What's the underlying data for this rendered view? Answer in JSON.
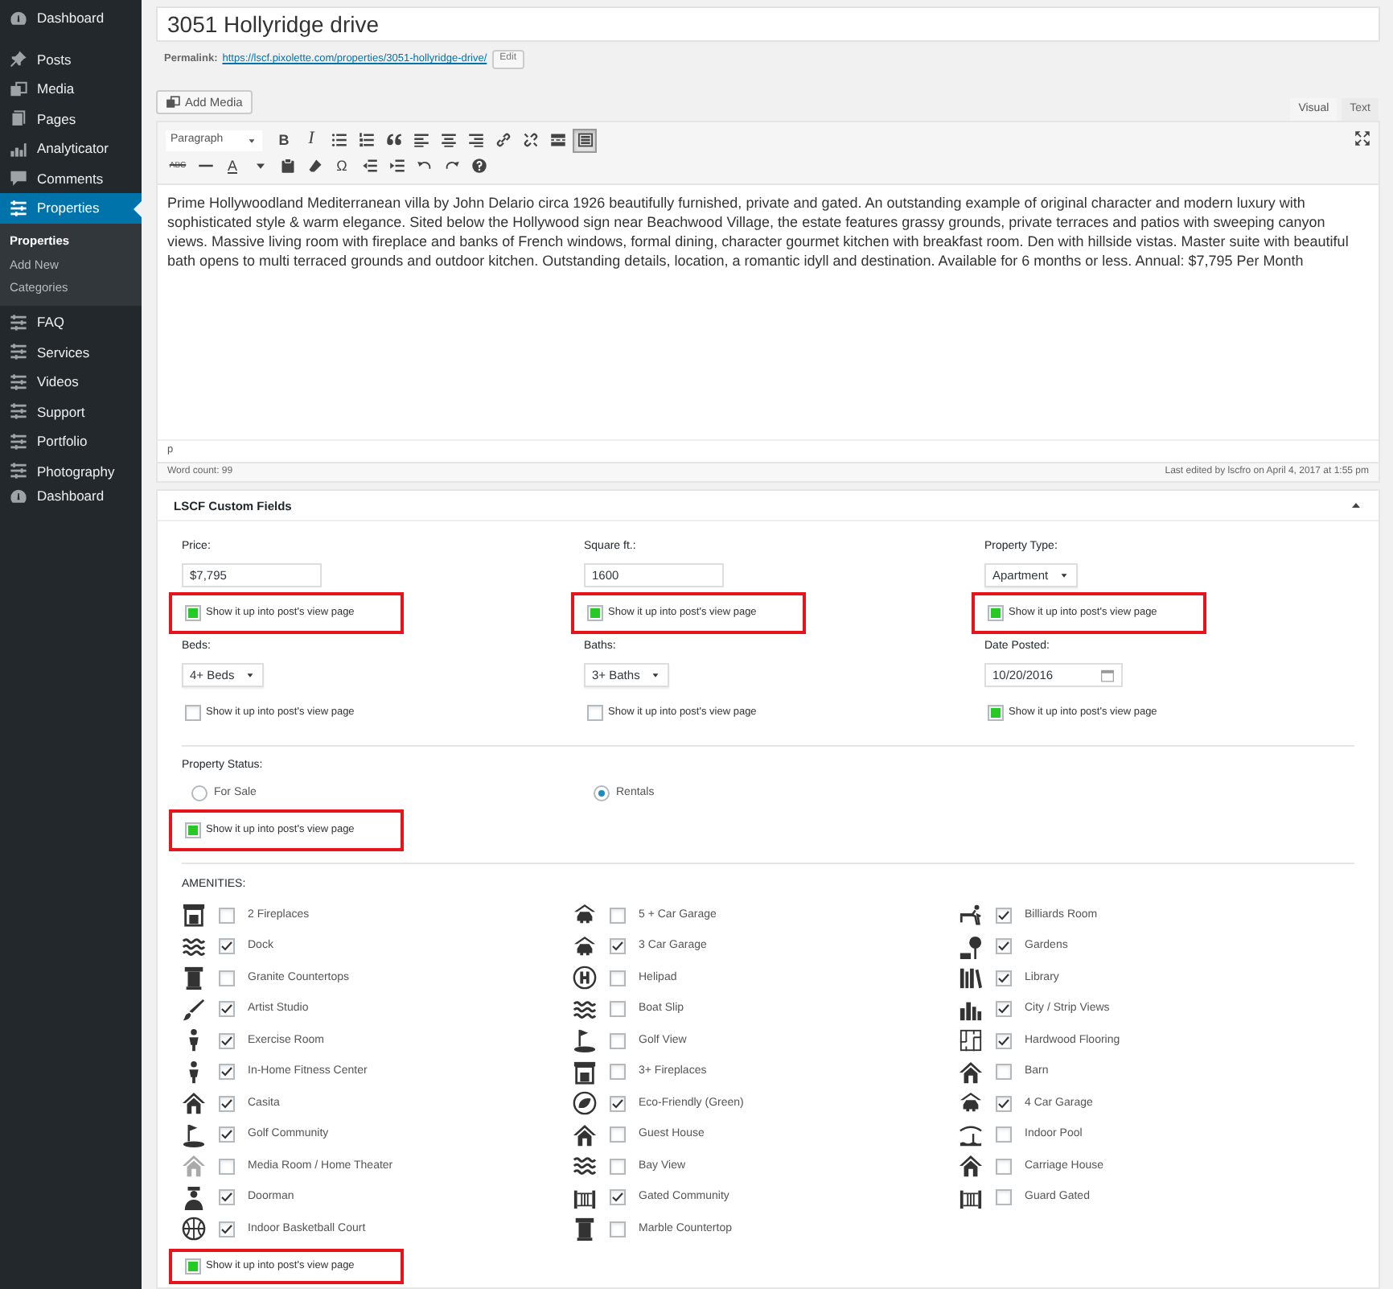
{
  "sidebar": {
    "items": [
      {
        "label": "Dashboard",
        "selected": false
      },
      {
        "label": "Posts",
        "selected": false
      },
      {
        "label": "Media",
        "selected": false
      },
      {
        "label": "Pages",
        "selected": false
      },
      {
        "label": "Analyticator",
        "selected": false
      },
      {
        "label": "Comments",
        "selected": false
      },
      {
        "label": "Properties",
        "selected": true,
        "children": [
          {
            "label": "Properties",
            "selected": true
          },
          {
            "label": "Add New",
            "selected": false
          },
          {
            "label": "Categories",
            "selected": false
          }
        ]
      },
      {
        "label": "FAQ",
        "selected": false
      },
      {
        "label": "Services",
        "selected": false
      },
      {
        "label": "Videos",
        "selected": false
      },
      {
        "label": "Support",
        "selected": false
      },
      {
        "label": "Portfolio",
        "selected": false
      },
      {
        "label": "Photography",
        "selected": false
      },
      {
        "label": "Dashboard",
        "selected": false
      }
    ]
  },
  "post": {
    "title": "3051 Hollyridge drive",
    "permalink_label": "Permalink:",
    "permalink": "https://lscf.pixolette.com/properties/3051-hollyridge-drive/",
    "edit_button": "Edit"
  },
  "editor": {
    "add_media": "Add Media",
    "tabs": [
      {
        "label": "Visual",
        "selected": true
      },
      {
        "label": "Text",
        "selected": false
      }
    ],
    "format": "Paragraph",
    "toolbar": [
      [
        {
          "kind": "glyph",
          "text": "B",
          "pressed": false
        },
        {
          "kind": "glyph",
          "text": "I",
          "pressed": false
        },
        {
          "kind": "icon",
          "pressed": false
        },
        {
          "kind": "icon",
          "pressed": false
        },
        {
          "kind": "icon",
          "pressed": false
        },
        {
          "kind": "icon",
          "pressed": false
        },
        {
          "kind": "icon",
          "pressed": false
        },
        {
          "kind": "icon",
          "pressed": false
        },
        {
          "kind": "icon",
          "pressed": false
        },
        {
          "kind": "icon",
          "pressed": false
        },
        {
          "kind": "icon",
          "pressed": false
        },
        {
          "kind": "icon",
          "pressed": true
        }
      ],
      [
        {
          "kind": "glyph",
          "text": "ABC",
          "pressed": false
        },
        {
          "kind": "icon",
          "pressed": false
        },
        {
          "kind": "glyph",
          "text": "A",
          "pressed": false
        },
        {
          "kind": "icon",
          "pressed": false
        },
        {
          "kind": "icon",
          "pressed": false
        },
        {
          "kind": "icon",
          "pressed": false
        },
        {
          "kind": "glyph",
          "text": "Ω",
          "pressed": false
        },
        {
          "kind": "icon",
          "pressed": false
        },
        {
          "kind": "icon",
          "pressed": false
        },
        {
          "kind": "icon",
          "pressed": false
        },
        {
          "kind": "icon",
          "pressed": false
        },
        {
          "kind": "icon",
          "pressed": false
        }
      ]
    ],
    "body": "Prime Hollywoodland Mediterranean villa by John Delario circa 1926 beautifully furnished, private and gated. An outstanding example of original character and modern luxury with sophisticated style & warm elegance. Sited below the Hollywood sign near Beachwood Village, the estate features grassy grounds, private terraces and patios with sweeping canyon views. Massive living room with fireplace and banks of French windows, formal dining, character gourmet kitchen with breakfast room. Den with hillside vistas. Master suite with beautiful bath opens to multi terraced grounds and outdoor kitchen. Outstanding details, location, a romantic idyll and destination. Available for 6 months or less. Annual: $7,795 Per Month",
    "path": "p",
    "word_count": "Word count: 99",
    "last_edited": "Last edited by lscfro on April 4, 2017 at 1:55 pm"
  },
  "custom_fields": {
    "title": "LSCF Custom Fields",
    "fields": [
      {
        "kind": "text",
        "label": "Price:",
        "value": "$7,795",
        "show": {
          "text": "Show it up into post's view page",
          "checked": true,
          "highlighted": true
        }
      },
      {
        "kind": "text",
        "label": "Square ft.:",
        "value": "1600",
        "show": {
          "text": "Show it up into post's view page",
          "checked": true,
          "highlighted": true
        }
      },
      {
        "kind": "select",
        "label": "Property Type:",
        "value": "Apartment",
        "show": {
          "text": "Show it up into post's view page",
          "checked": true,
          "highlighted": true
        }
      },
      {
        "kind": "select",
        "label": "Beds:",
        "value": "4+ Beds",
        "show": {
          "text": "Show it up into post's view page",
          "checked": false,
          "highlighted": false
        }
      },
      {
        "kind": "select",
        "label": "Baths:",
        "value": "3+ Baths",
        "show": {
          "text": "Show it up into post's view page",
          "checked": false,
          "highlighted": false
        }
      },
      {
        "kind": "date",
        "label": "Date Posted:",
        "value": "10/20/2016",
        "show": {
          "text": "Show it up into post's view page",
          "checked": true,
          "highlighted": false
        }
      }
    ],
    "status": {
      "label": "Property Status:",
      "options": [
        {
          "label": "For Sale",
          "selected": false
        },
        {
          "label": "Rentals",
          "selected": true
        }
      ],
      "show": {
        "text": "Show it up into post's view page",
        "checked": true,
        "highlighted": true
      }
    },
    "amenities": {
      "label": "AMENITIES:",
      "columns": [
        [
          {
            "label": "2 Fireplaces",
            "checked": false
          },
          {
            "label": "Dock",
            "checked": true
          },
          {
            "label": "Granite Countertops",
            "checked": false
          },
          {
            "label": "Artist Studio",
            "checked": true
          },
          {
            "label": "Exercise Room",
            "checked": true
          },
          {
            "label": "In-Home Fitness Center",
            "checked": true
          },
          {
            "label": "Casita",
            "checked": true
          },
          {
            "label": "Golf Community",
            "checked": true
          },
          {
            "label": "Media Room / Home Theater",
            "checked": false
          },
          {
            "label": "Doorman",
            "checked": true
          },
          {
            "label": "Indoor Basketball Court",
            "checked": true
          }
        ],
        [
          {
            "label": "5 + Car Garage",
            "checked": false
          },
          {
            "label": "3 Car Garage",
            "checked": true
          },
          {
            "label": "Helipad",
            "checked": false
          },
          {
            "label": "Boat Slip",
            "checked": false
          },
          {
            "label": "Golf View",
            "checked": false
          },
          {
            "label": "3+ Fireplaces",
            "checked": false
          },
          {
            "label": "Eco-Friendly (Green)",
            "checked": true
          },
          {
            "label": "Guest House",
            "checked": false
          },
          {
            "label": "Bay View",
            "checked": false
          },
          {
            "label": "Gated Community",
            "checked": true
          },
          {
            "label": "Marble Countertop",
            "checked": false
          }
        ],
        [
          {
            "label": "Billiards Room",
            "checked": true
          },
          {
            "label": "Gardens",
            "checked": true
          },
          {
            "label": "Library",
            "checked": true
          },
          {
            "label": "City / Strip Views",
            "checked": true
          },
          {
            "label": "Hardwood Flooring",
            "checked": true
          },
          {
            "label": "Barn",
            "checked": false
          },
          {
            "label": "4 Car Garage",
            "checked": true
          },
          {
            "label": "Indoor Pool",
            "checked": false
          },
          {
            "label": "Carriage House",
            "checked": false
          },
          {
            "label": "Guard Gated",
            "checked": false
          }
        ]
      ],
      "show": {
        "text": "Show it up into post's view page",
        "checked": true,
        "highlighted": true
      }
    }
  }
}
